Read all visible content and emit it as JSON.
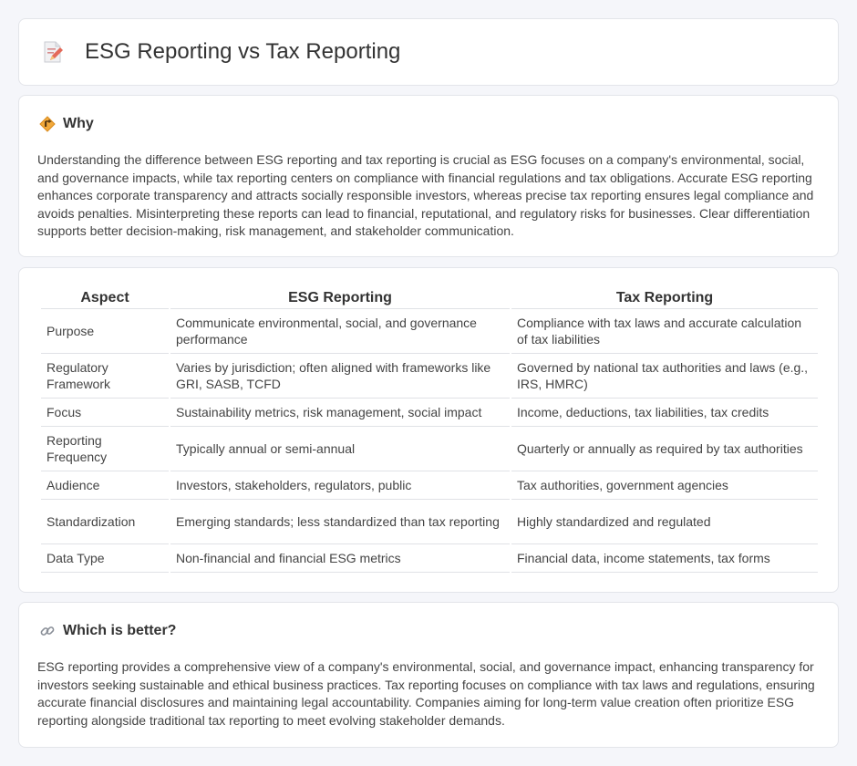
{
  "header": {
    "title": "ESG Reporting vs Tax Reporting",
    "icon": "document-pencil-icon"
  },
  "why": {
    "title": "Why",
    "icon": "diamond-sign-icon",
    "text": "Understanding the difference between ESG reporting and tax reporting is crucial as ESG focuses on a company's environmental, social, and governance impacts, while tax reporting centers on compliance with financial regulations and tax obligations. Accurate ESG reporting enhances corporate transparency and attracts socially responsible investors, whereas precise tax reporting ensures legal compliance and avoids penalties. Misinterpreting these reports can lead to financial, reputational, and regulatory risks for businesses. Clear differentiation supports better decision-making, risk management, and stakeholder communication."
  },
  "table": {
    "headers": [
      "Aspect",
      "ESG Reporting",
      "Tax Reporting"
    ],
    "rows": [
      [
        "Purpose",
        "Communicate environmental, social, and governance performance",
        "Compliance with tax laws and accurate calculation of tax liabilities"
      ],
      [
        "Regulatory Framework",
        "Varies by jurisdiction; often aligned with frameworks like GRI, SASB, TCFD",
        "Governed by national tax authorities and laws (e.g., IRS, HMRC)"
      ],
      [
        "Focus",
        "Sustainability metrics, risk management, social impact",
        "Income, deductions, tax liabilities, tax credits"
      ],
      [
        "Reporting Frequency",
        "Typically annual or semi-annual",
        "Quarterly or annually as required by tax authorities"
      ],
      [
        "Audience",
        "Investors, stakeholders, regulators, public",
        "Tax authorities, government agencies"
      ],
      [
        "Standardization",
        "Emerging standards; less standardized than tax reporting",
        "Highly standardized and regulated"
      ],
      [
        "Data Type",
        "Non-financial and financial ESG metrics",
        "Financial data, income statements, tax forms"
      ]
    ]
  },
  "better": {
    "title": "Which is better?",
    "icon": "link-icon",
    "text": "ESG reporting provides a comprehensive view of a company's environmental, social, and governance impact, enhancing transparency for investors seeking sustainable and ethical business practices. Tax reporting focuses on compliance with tax laws and regulations, ensuring accurate financial disclosures and maintaining legal accountability. Companies aiming for long-term value creation often prioritize ESG reporting alongside traditional tax reporting to meet evolving stakeholder demands."
  }
}
